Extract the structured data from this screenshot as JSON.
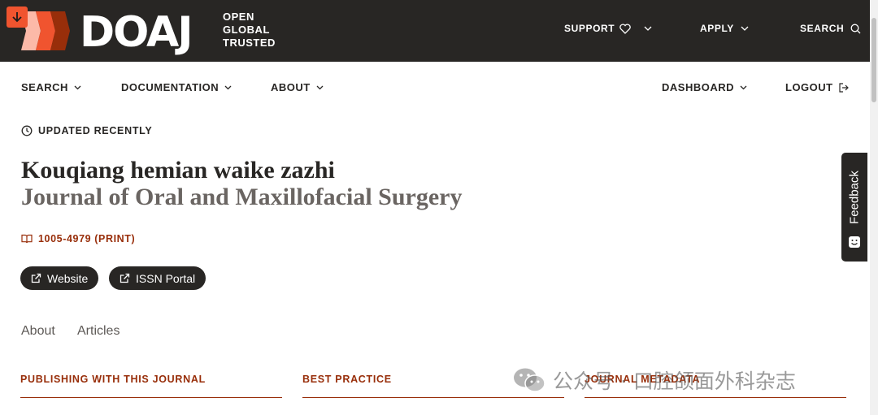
{
  "header": {
    "logo_word": "DOAJ",
    "logo_tagline": [
      "OPEN",
      "GLOBAL",
      "TRUSTED"
    ],
    "nav": [
      {
        "label": "SUPPORT",
        "icon": "heart-icon"
      },
      {
        "label": "APPLY"
      },
      {
        "label": "SEARCH",
        "icon": "search-icon"
      }
    ]
  },
  "subnav": {
    "left": [
      "SEARCH",
      "DOCUMENTATION",
      "ABOUT"
    ],
    "dashboard": "DASHBOARD",
    "logout": "LOGOUT"
  },
  "journal": {
    "status": "UPDATED RECENTLY",
    "title": "Kouqiang hemian waike zazhi",
    "alt_title": "Journal of Oral and Maxillofacial Surgery",
    "issn": "1005-4979 (PRINT)",
    "buttons": [
      "Website",
      "ISSN Portal"
    ]
  },
  "tabs": [
    "About",
    "Articles"
  ],
  "sections": [
    "PUBLISHING WITH THIS JOURNAL",
    "BEST PRACTICE",
    "JOURNAL METADATA"
  ],
  "feedback_label": "Feedback",
  "watermark": "公众号 · 口腔颌面外科杂志",
  "colors": {
    "header_bg": "#282624",
    "accent": "#982e0a",
    "logo_orange": "#f0542f"
  }
}
